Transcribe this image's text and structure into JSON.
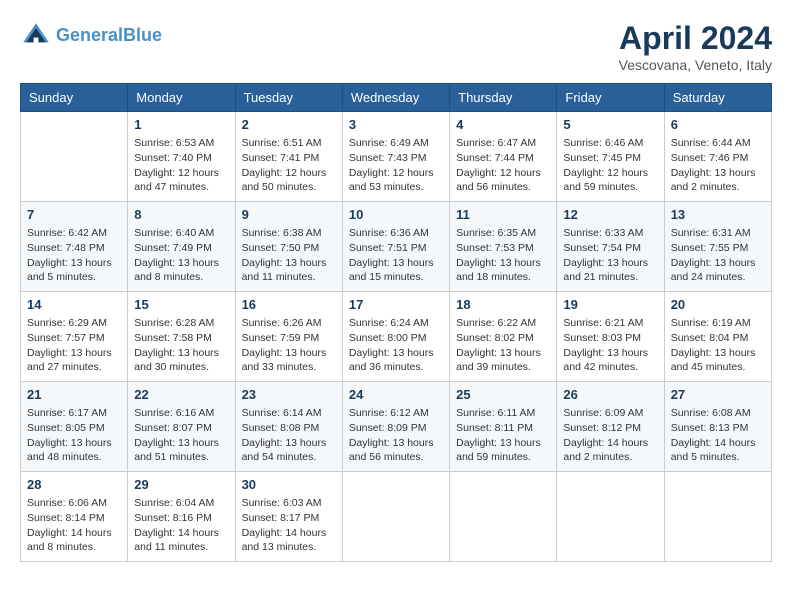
{
  "header": {
    "logo_line1": "General",
    "logo_line2": "Blue",
    "month_title": "April 2024",
    "location": "Vescovana, Veneto, Italy"
  },
  "days_of_week": [
    "Sunday",
    "Monday",
    "Tuesday",
    "Wednesday",
    "Thursday",
    "Friday",
    "Saturday"
  ],
  "weeks": [
    [
      {
        "day": "",
        "content": ""
      },
      {
        "day": "1",
        "content": "Sunrise: 6:53 AM\nSunset: 7:40 PM\nDaylight: 12 hours\nand 47 minutes."
      },
      {
        "day": "2",
        "content": "Sunrise: 6:51 AM\nSunset: 7:41 PM\nDaylight: 12 hours\nand 50 minutes."
      },
      {
        "day": "3",
        "content": "Sunrise: 6:49 AM\nSunset: 7:43 PM\nDaylight: 12 hours\nand 53 minutes."
      },
      {
        "day": "4",
        "content": "Sunrise: 6:47 AM\nSunset: 7:44 PM\nDaylight: 12 hours\nand 56 minutes."
      },
      {
        "day": "5",
        "content": "Sunrise: 6:46 AM\nSunset: 7:45 PM\nDaylight: 12 hours\nand 59 minutes."
      },
      {
        "day": "6",
        "content": "Sunrise: 6:44 AM\nSunset: 7:46 PM\nDaylight: 13 hours\nand 2 minutes."
      }
    ],
    [
      {
        "day": "7",
        "content": "Sunrise: 6:42 AM\nSunset: 7:48 PM\nDaylight: 13 hours\nand 5 minutes."
      },
      {
        "day": "8",
        "content": "Sunrise: 6:40 AM\nSunset: 7:49 PM\nDaylight: 13 hours\nand 8 minutes."
      },
      {
        "day": "9",
        "content": "Sunrise: 6:38 AM\nSunset: 7:50 PM\nDaylight: 13 hours\nand 11 minutes."
      },
      {
        "day": "10",
        "content": "Sunrise: 6:36 AM\nSunset: 7:51 PM\nDaylight: 13 hours\nand 15 minutes."
      },
      {
        "day": "11",
        "content": "Sunrise: 6:35 AM\nSunset: 7:53 PM\nDaylight: 13 hours\nand 18 minutes."
      },
      {
        "day": "12",
        "content": "Sunrise: 6:33 AM\nSunset: 7:54 PM\nDaylight: 13 hours\nand 21 minutes."
      },
      {
        "day": "13",
        "content": "Sunrise: 6:31 AM\nSunset: 7:55 PM\nDaylight: 13 hours\nand 24 minutes."
      }
    ],
    [
      {
        "day": "14",
        "content": "Sunrise: 6:29 AM\nSunset: 7:57 PM\nDaylight: 13 hours\nand 27 minutes."
      },
      {
        "day": "15",
        "content": "Sunrise: 6:28 AM\nSunset: 7:58 PM\nDaylight: 13 hours\nand 30 minutes."
      },
      {
        "day": "16",
        "content": "Sunrise: 6:26 AM\nSunset: 7:59 PM\nDaylight: 13 hours\nand 33 minutes."
      },
      {
        "day": "17",
        "content": "Sunrise: 6:24 AM\nSunset: 8:00 PM\nDaylight: 13 hours\nand 36 minutes."
      },
      {
        "day": "18",
        "content": "Sunrise: 6:22 AM\nSunset: 8:02 PM\nDaylight: 13 hours\nand 39 minutes."
      },
      {
        "day": "19",
        "content": "Sunrise: 6:21 AM\nSunset: 8:03 PM\nDaylight: 13 hours\nand 42 minutes."
      },
      {
        "day": "20",
        "content": "Sunrise: 6:19 AM\nSunset: 8:04 PM\nDaylight: 13 hours\nand 45 minutes."
      }
    ],
    [
      {
        "day": "21",
        "content": "Sunrise: 6:17 AM\nSunset: 8:05 PM\nDaylight: 13 hours\nand 48 minutes."
      },
      {
        "day": "22",
        "content": "Sunrise: 6:16 AM\nSunset: 8:07 PM\nDaylight: 13 hours\nand 51 minutes."
      },
      {
        "day": "23",
        "content": "Sunrise: 6:14 AM\nSunset: 8:08 PM\nDaylight: 13 hours\nand 54 minutes."
      },
      {
        "day": "24",
        "content": "Sunrise: 6:12 AM\nSunset: 8:09 PM\nDaylight: 13 hours\nand 56 minutes."
      },
      {
        "day": "25",
        "content": "Sunrise: 6:11 AM\nSunset: 8:11 PM\nDaylight: 13 hours\nand 59 minutes."
      },
      {
        "day": "26",
        "content": "Sunrise: 6:09 AM\nSunset: 8:12 PM\nDaylight: 14 hours\nand 2 minutes."
      },
      {
        "day": "27",
        "content": "Sunrise: 6:08 AM\nSunset: 8:13 PM\nDaylight: 14 hours\nand 5 minutes."
      }
    ],
    [
      {
        "day": "28",
        "content": "Sunrise: 6:06 AM\nSunset: 8:14 PM\nDaylight: 14 hours\nand 8 minutes."
      },
      {
        "day": "29",
        "content": "Sunrise: 6:04 AM\nSunset: 8:16 PM\nDaylight: 14 hours\nand 11 minutes."
      },
      {
        "day": "30",
        "content": "Sunrise: 6:03 AM\nSunset: 8:17 PM\nDaylight: 14 hours\nand 13 minutes."
      },
      {
        "day": "",
        "content": ""
      },
      {
        "day": "",
        "content": ""
      },
      {
        "day": "",
        "content": ""
      },
      {
        "day": "",
        "content": ""
      }
    ]
  ]
}
